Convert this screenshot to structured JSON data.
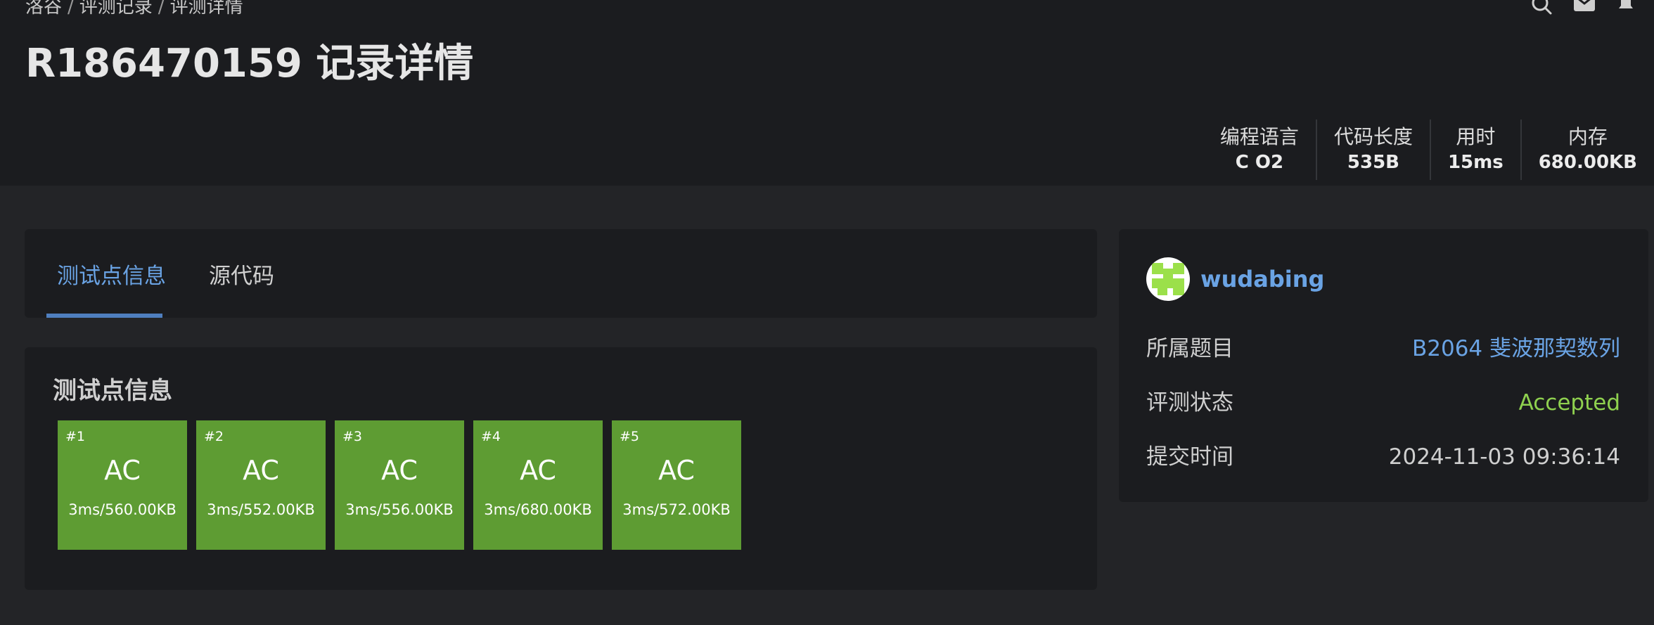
{
  "breadcrumb": [
    "洛谷",
    "评测记录",
    "评测详情"
  ],
  "breadcrumb_sep": "/",
  "title": "R186470159 记录详情",
  "header_icons": [
    "search-icon",
    "mail-icon",
    "bell-icon"
  ],
  "stats": [
    {
      "label": "编程语言",
      "value": "C O2"
    },
    {
      "label": "代码长度",
      "value": "535B"
    },
    {
      "label": "用时",
      "value": "15ms"
    },
    {
      "label": "内存",
      "value": "680.00KB"
    }
  ],
  "tabs": [
    {
      "label": "测试点信息",
      "active": true
    },
    {
      "label": "源代码",
      "active": false
    }
  ],
  "section_title": "测试点信息",
  "cases": [
    {
      "num": "#1",
      "status": "AC",
      "info": "3ms/560.00KB"
    },
    {
      "num": "#2",
      "status": "AC",
      "info": "3ms/552.00KB"
    },
    {
      "num": "#3",
      "status": "AC",
      "info": "3ms/556.00KB"
    },
    {
      "num": "#4",
      "status": "AC",
      "info": "3ms/680.00KB"
    },
    {
      "num": "#5",
      "status": "AC",
      "info": "3ms/572.00KB"
    }
  ],
  "user": {
    "name": "wudabing"
  },
  "info_rows": [
    {
      "label": "所属题目",
      "value": "B2064 斐波那契数列",
      "color": "#6aa3e4"
    },
    {
      "label": "评测状态",
      "value": "Accepted",
      "color": "#8fd14f"
    },
    {
      "label": "提交时间",
      "value": "2024-11-03 09:36:14",
      "color": "#cfcfcf"
    }
  ],
  "colors": {
    "accent": "#6aa3e4",
    "accepted": "#8fd14f",
    "case_bg": "#5e9c33",
    "card_bg": "#1b1c1f",
    "page_bg": "#232427"
  }
}
